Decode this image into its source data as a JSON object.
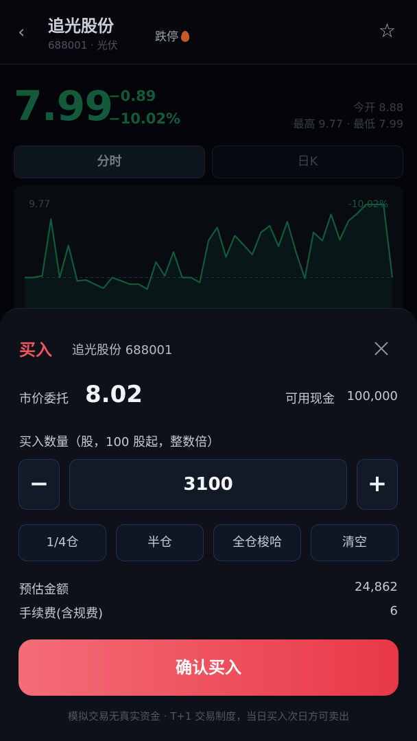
{
  "header": {
    "back_icon": "chevron-left-icon",
    "stock_name": "追光股份",
    "stock_sub": "688001 · 光伏",
    "limit_tag": "跌停",
    "fire_icon": "fire-icon",
    "star_icon": "star-icon"
  },
  "quote": {
    "price": "7.99",
    "change": "−0.89",
    "change_pct": "−10.02%",
    "open_text": "今开 8.88",
    "hilo_text": "最高 9.77 · 最低 7.99",
    "down_color": "#18784e"
  },
  "tabs": [
    {
      "label": "分时",
      "active": true
    },
    {
      "label": "日K",
      "active": false
    }
  ],
  "chart": {
    "high_label": "9.77",
    "pct_label": "-10.02%"
  },
  "chart_data": {
    "type": "line",
    "ylim": [
      8.45,
      9.77
    ],
    "reference": 8.88,
    "y": [
      8.88,
      8.88,
      8.9,
      9.59,
      8.88,
      9.27,
      8.84,
      8.85,
      8.8,
      8.75,
      8.88,
      8.84,
      8.8,
      8.8,
      8.74,
      9.07,
      8.9,
      9.19,
      8.88,
      8.88,
      8.82,
      9.33,
      9.49,
      9.13,
      9.39,
      9.28,
      9.16,
      9.43,
      9.51,
      9.26,
      9.56,
      9.19,
      8.87,
      9.43,
      9.33,
      9.65,
      9.34,
      9.57,
      9.66,
      9.77,
      9.77,
      9.77,
      8.88
    ]
  },
  "sheet": {
    "title": "买入",
    "stock": "追光股份 688001",
    "close_icon": "close-icon",
    "order_type": "市价委托",
    "order_price": "8.02",
    "cash_label": "可用现金",
    "cash_value": "100,000",
    "qty_label": "买入数量（股，100 股起，整数倍）",
    "minus": "−",
    "plus": "+",
    "quantity": "3100",
    "quick": [
      "1/4仓",
      "半仓",
      "全仓梭哈",
      "清空"
    ],
    "estimate_label": "预估金额",
    "estimate_value": "24,862",
    "fee_label": "手续费(含规费)",
    "fee_value": "6",
    "confirm_label": "确认买入",
    "footnote": "模拟交易无真实资金 · T+1 交易制度，当日买入次日方可卖出",
    "accent_color": "#f2555e"
  }
}
